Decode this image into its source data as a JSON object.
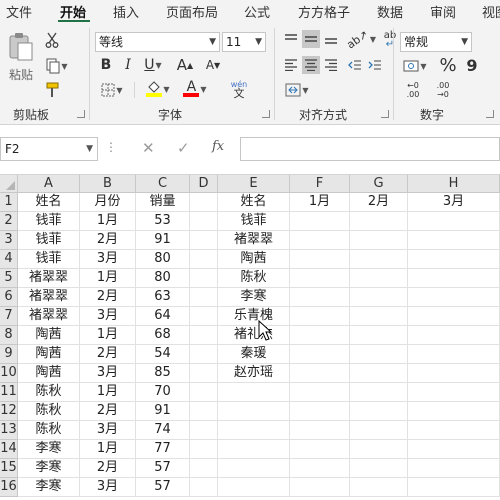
{
  "tabs": [
    "文件",
    "开始",
    "插入",
    "页面布局",
    "公式",
    "方方格子",
    "数据",
    "审阅",
    "视图"
  ],
  "ribbon": {
    "clipboard": {
      "paste_label": "粘贴",
      "group_label": "剪贴板"
    },
    "font": {
      "family": "等线",
      "size": "11",
      "bold": "B",
      "italic": "I",
      "underline": "U",
      "grow": "A",
      "shrink": "A",
      "font_color_glyph": "A",
      "fill_color_glyph": "A",
      "phonetic_glyph": "wén",
      "phonetic_sub": "文",
      "group_label": "字体",
      "fill_color": "#ffff00",
      "font_color": "#ff0000"
    },
    "alignment": {
      "group_label": "对齐方式",
      "wrap_glyph": "ab"
    },
    "number": {
      "format": "常规",
      "percent": "%",
      "comma": "9",
      "group_label": "数字",
      "inc_decimal": "←0 .00",
      "dec_decimal": ".00 →0"
    }
  },
  "formula_bar": {
    "name_box": "F2",
    "cancel": "✕",
    "enter": "✓",
    "fx": "fx",
    "value": ""
  },
  "columns": [
    "A",
    "B",
    "C",
    "D",
    "E",
    "F",
    "G",
    "H"
  ],
  "rows": [
    {
      "n": "1",
      "A": "姓名",
      "B": "月份",
      "C": "销量",
      "D": "",
      "E": "姓名",
      "F": "1月",
      "G": "2月",
      "H": "3月"
    },
    {
      "n": "2",
      "A": "钱菲",
      "B": "1月",
      "C": "53",
      "D": "",
      "E": "钱菲",
      "F": "",
      "G": "",
      "H": ""
    },
    {
      "n": "3",
      "A": "钱菲",
      "B": "2月",
      "C": "91",
      "D": "",
      "E": "褚翠翠",
      "F": "",
      "G": "",
      "H": ""
    },
    {
      "n": "4",
      "A": "钱菲",
      "B": "3月",
      "C": "80",
      "D": "",
      "E": "陶茜",
      "F": "",
      "G": "",
      "H": ""
    },
    {
      "n": "5",
      "A": "褚翠翠",
      "B": "1月",
      "C": "80",
      "D": "",
      "E": "陈秋",
      "F": "",
      "G": "",
      "H": ""
    },
    {
      "n": "6",
      "A": "褚翠翠",
      "B": "2月",
      "C": "63",
      "D": "",
      "E": "李寒",
      "F": "",
      "G": "",
      "H": ""
    },
    {
      "n": "7",
      "A": "褚翠翠",
      "B": "3月",
      "C": "64",
      "D": "",
      "E": "乐青槐",
      "F": "",
      "G": "",
      "H": ""
    },
    {
      "n": "8",
      "A": "陶茜",
      "B": "1月",
      "C": "68",
      "D": "",
      "E": "褚礼杰",
      "F": "",
      "G": "",
      "H": ""
    },
    {
      "n": "9",
      "A": "陶茜",
      "B": "2月",
      "C": "54",
      "D": "",
      "E": "秦瑗",
      "F": "",
      "G": "",
      "H": ""
    },
    {
      "n": "10",
      "A": "陶茜",
      "B": "3月",
      "C": "85",
      "D": "",
      "E": "赵亦瑶",
      "F": "",
      "G": "",
      "H": ""
    },
    {
      "n": "11",
      "A": "陈秋",
      "B": "1月",
      "C": "70",
      "D": "",
      "E": "",
      "F": "",
      "G": "",
      "H": ""
    },
    {
      "n": "12",
      "A": "陈秋",
      "B": "2月",
      "C": "91",
      "D": "",
      "E": "",
      "F": "",
      "G": "",
      "H": ""
    },
    {
      "n": "13",
      "A": "陈秋",
      "B": "3月",
      "C": "74",
      "D": "",
      "E": "",
      "F": "",
      "G": "",
      "H": ""
    },
    {
      "n": "14",
      "A": "李寒",
      "B": "1月",
      "C": "77",
      "D": "",
      "E": "",
      "F": "",
      "G": "",
      "H": ""
    },
    {
      "n": "15",
      "A": "李寒",
      "B": "2月",
      "C": "57",
      "D": "",
      "E": "",
      "F": "",
      "G": "",
      "H": ""
    },
    {
      "n": "16",
      "A": "李寒",
      "B": "3月",
      "C": "57",
      "D": "",
      "E": "",
      "F": "",
      "G": "",
      "H": ""
    }
  ],
  "colors": {
    "excel_green": "#217346"
  }
}
